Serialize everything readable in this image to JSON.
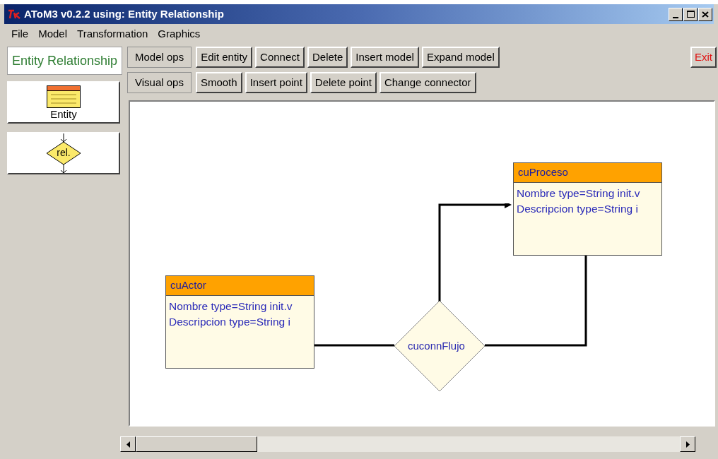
{
  "window": {
    "title": "AToM3 v0.2.2 using: Entity Relationship"
  },
  "menu": [
    "File",
    "Model",
    "Transformation",
    "Graphics"
  ],
  "palette": {
    "title": "Entity Relationship",
    "items": [
      {
        "kind": "entity",
        "label": "Entity"
      },
      {
        "kind": "relationship",
        "label": "rel."
      }
    ]
  },
  "toolbar_rows": [
    [
      "Model ops",
      "Edit entity",
      "Connect",
      "Delete",
      "Insert model",
      "Expand model"
    ],
    [
      "Visual ops",
      "Smooth",
      "Insert point",
      "Delete point",
      "Change connector"
    ]
  ],
  "exit_button": "Exit",
  "diagram": {
    "entities": [
      {
        "name": "cuProceso",
        "attributes": [
          "Nombre type=String init.v",
          "Descripcion type=String i"
        ]
      },
      {
        "name": "cuActor",
        "attributes": [
          "Nombre type=String init.v",
          "Descripcion type=String i"
        ]
      }
    ],
    "relationship": {
      "name": "cuconnFlujo"
    }
  }
}
